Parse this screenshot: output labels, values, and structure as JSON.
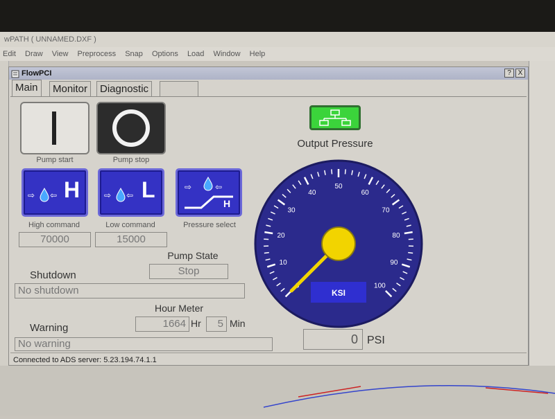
{
  "parent_window": {
    "title": "wPATH ( UNNAMED.DXF )",
    "menu": [
      "Edit",
      "Draw",
      "View",
      "Preprocess",
      "Snap",
      "Options",
      "Load",
      "Window",
      "Help"
    ]
  },
  "dialog": {
    "title": "FlowPCI",
    "caption_buttons": [
      "?",
      "X"
    ]
  },
  "tabs": [
    {
      "label": "Main",
      "active": true
    },
    {
      "label": "Monitor",
      "active": false
    },
    {
      "label": "Diagnostic",
      "active": false
    },
    {
      "label": "",
      "active": false
    }
  ],
  "pump": {
    "start_label": "Pump start",
    "stop_label": "Pump stop"
  },
  "commands": {
    "high_label": "High command",
    "low_label": "Low command",
    "pressure_select_label": "Pressure select",
    "high_value": "70000",
    "low_value": "15000",
    "high_letter": "H",
    "low_letter": "L",
    "select_letter": "H"
  },
  "pump_state": {
    "label": "Pump State",
    "value": "Stop"
  },
  "shutdown": {
    "label": "Shutdown",
    "value": "No shutdown"
  },
  "hour_meter": {
    "label": "Hour Meter",
    "hours": "1664",
    "hours_unit": "Hr",
    "minutes": "5",
    "minutes_unit": "Min"
  },
  "warning": {
    "label": "Warning",
    "value": "No warning"
  },
  "status_bar": "Connected to ADS server: 5.23.194.74.1.1",
  "output_pressure": {
    "label": "Output Pressure",
    "unit": "KSI",
    "ticks": [
      "0",
      "10",
      "20",
      "30",
      "40",
      "50",
      "60",
      "70",
      "80",
      "90",
      "100"
    ],
    "min": 0,
    "max": 100,
    "needle_value": 0,
    "readout_value": "0",
    "readout_unit": "PSI"
  },
  "colors": {
    "button_blue": "#3432c4",
    "gauge_face": "#2b2a8c",
    "needle": "#f2d400",
    "network_icon": "#3bd43b"
  },
  "icons": {
    "network": "network-icon",
    "pump_start": "power-line-icon",
    "pump_stop": "power-ring-icon",
    "water": "water-drop-icon",
    "arrows": "arrow-icon",
    "ramp": "ramp-icon"
  }
}
